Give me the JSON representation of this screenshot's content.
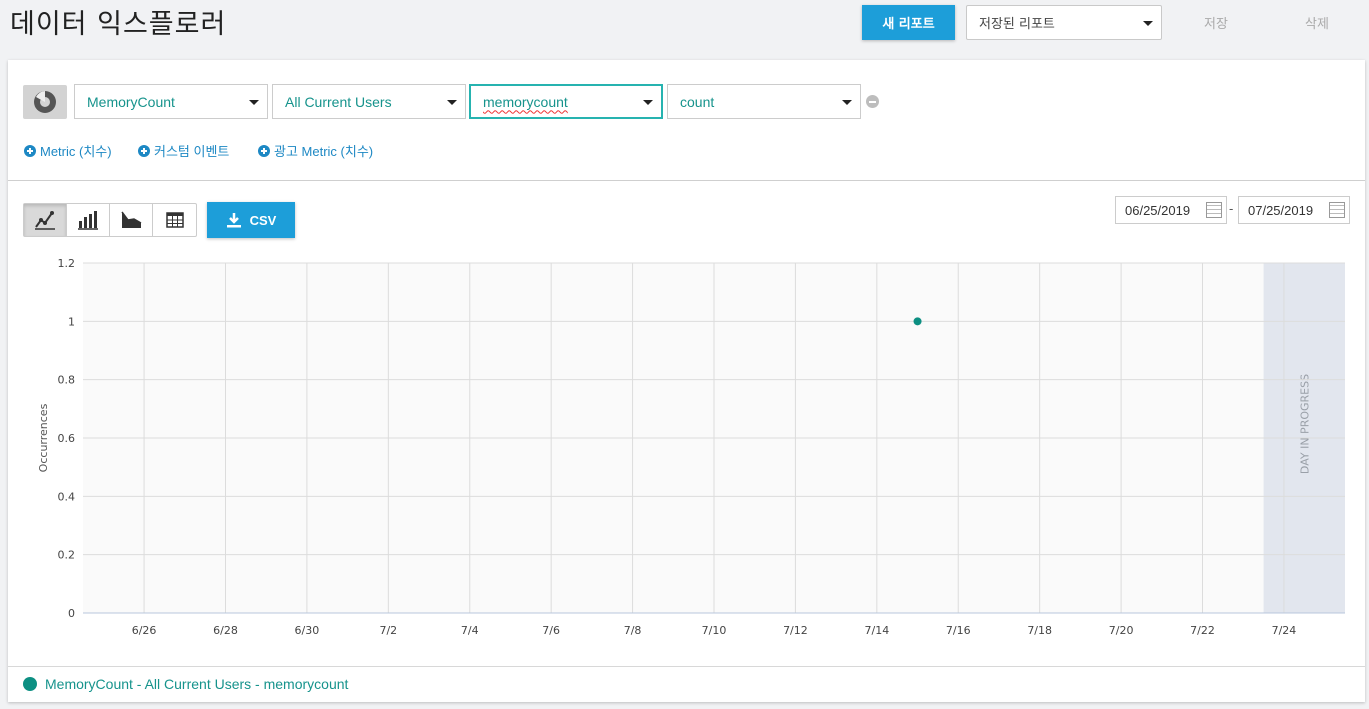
{
  "header": {
    "title": "데이터 익스플로러",
    "new_report_label": "새 리포트",
    "saved_reports_value": "저장된 리포트",
    "save_label": "저장",
    "delete_label": "삭제"
  },
  "filters": {
    "event_name": "MemoryCount",
    "segment": "All Current Users",
    "metric_param": "memorycount",
    "aggregation": "count"
  },
  "add_links": {
    "metric": "Metric (치수)",
    "custom_event": "커스텀 이벤트",
    "ad_metric": "광고 Metric (치수)"
  },
  "toolbar": {
    "csv_label": "CSV",
    "views": [
      "line-chart-icon",
      "bar-chart-icon",
      "area-chart-icon",
      "table-icon"
    ],
    "start_date": "06/25/2019",
    "date_separator": "-",
    "end_date": "07/25/2019"
  },
  "chart_data": {
    "type": "scatter",
    "ylabel": "Occurrences",
    "xlabel": "",
    "ylim": [
      0,
      1.2
    ],
    "yticks": [
      "0",
      "0.2",
      "0.4",
      "0.6",
      "0.8",
      "1",
      "1.2"
    ],
    "xticks": [
      "6/26",
      "6/28",
      "6/30",
      "7/2",
      "7/4",
      "7/6",
      "7/8",
      "7/10",
      "7/12",
      "7/14",
      "7/16",
      "7/18",
      "7/20",
      "7/22",
      "7/24"
    ],
    "x_range": [
      "6/25",
      "7/25"
    ],
    "series": [
      {
        "name": "MemoryCount - All Current Users - memorycount",
        "color": "#0c8f82",
        "points": [
          {
            "x": "7/15",
            "y": 1
          }
        ]
      }
    ],
    "in_progress_label": "DAY IN PROGRESS",
    "in_progress_range": [
      "7/24",
      "7/25"
    ],
    "grid": true
  },
  "legend": {
    "label": "MemoryCount - All Current Users - memorycount",
    "color": "#0c8f82"
  }
}
